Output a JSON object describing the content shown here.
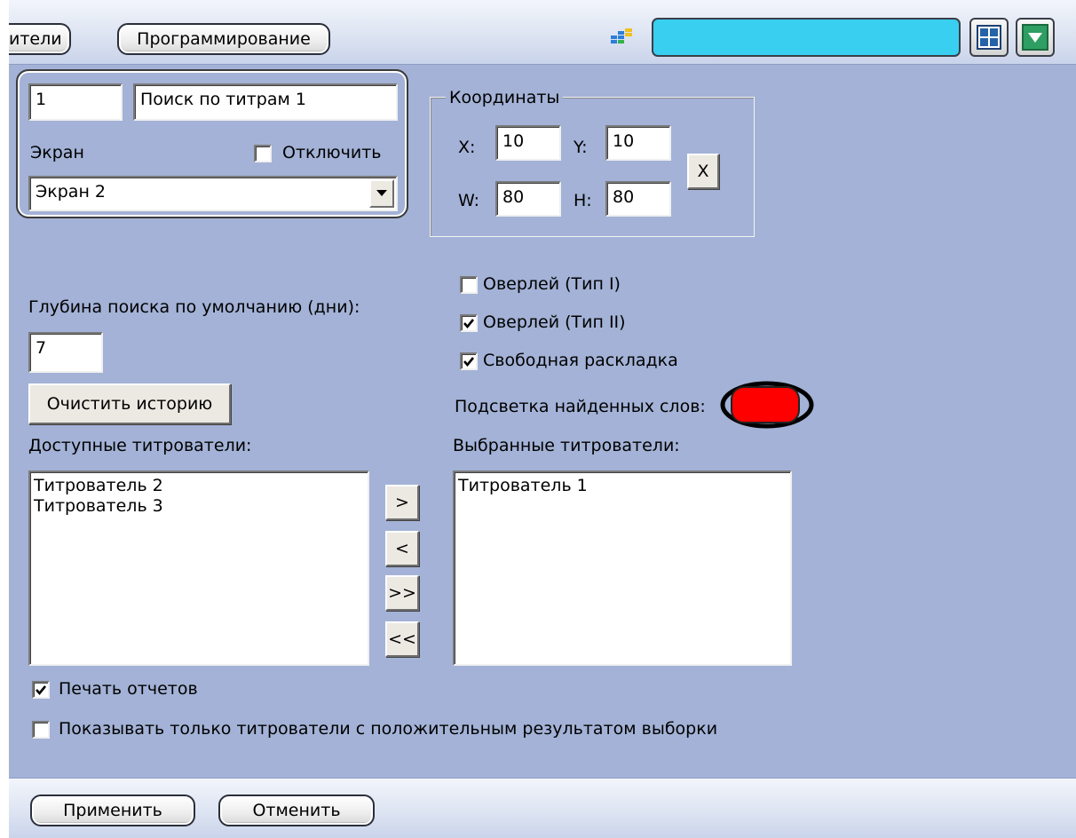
{
  "top_bar": {
    "tab_users": "ители",
    "tab_programming": "Программирование",
    "app_icon": "layout-edit-icon",
    "color_field": "",
    "layout_icon": "grid-layout-icon",
    "dropdown_icon": "chevron-down-icon",
    "colors": {
      "color_field": "#38cff0",
      "dropdown_green": "#2e9e62"
    }
  },
  "general": {
    "id_value": "1",
    "name_value": "Поиск по титрам 1",
    "screen_label": "Экран",
    "disable_label": "Отключить",
    "disable_checked": false,
    "screen_select_value": "Экран 2"
  },
  "coordinates": {
    "title": "Координаты",
    "x_label": "X:",
    "x_value": "10",
    "y_label": "Y:",
    "y_value": "10",
    "w_label": "W:",
    "w_value": "80",
    "h_label": "H:",
    "h_value": "80",
    "set_button_label": "X"
  },
  "search": {
    "depth_label": "Глубина поиска по умолчанию (дни):",
    "depth_value": "7",
    "clear_history_label": "Очистить историю"
  },
  "options": {
    "overlay1_label": "Оверлей (Тип I)",
    "overlay1_checked": false,
    "overlay2_label": "Оверлей (Тип II)",
    "overlay2_checked": true,
    "free_layout_label": "Свободная раскладка",
    "free_layout_checked": true,
    "highlight_label": "Подсветка найденных слов:",
    "highlight_color": "#ff0000"
  },
  "available": {
    "label": "Доступные титрователи:",
    "items": [
      "Титрователь 2",
      "Титрователь 3"
    ]
  },
  "selected": {
    "label": "Выбранные титрователи:",
    "items": [
      "Титрователь 1"
    ]
  },
  "transfer": {
    "add": ">",
    "remove": "<",
    "add_all": ">>",
    "remove_all": "<<"
  },
  "print_reports": {
    "label": "Печать отчетов",
    "checked": true
  },
  "show_positive": {
    "label": "Показывать только титрователи с положительным результатом выборки",
    "checked": false
  },
  "footer": {
    "apply_label": "Применить",
    "cancel_label": "Отменить"
  }
}
